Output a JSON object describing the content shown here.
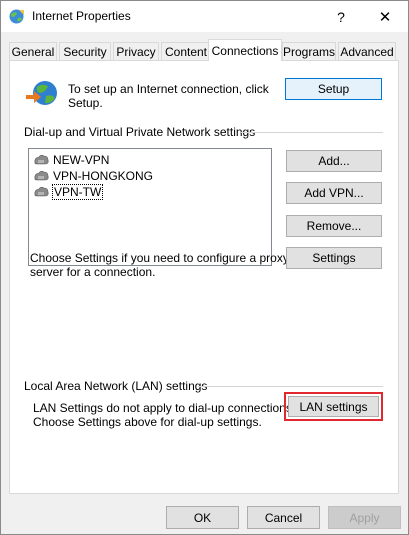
{
  "window": {
    "title": "Internet Properties",
    "help_glyph": "?",
    "close_glyph": "✕"
  },
  "tabs": [
    {
      "label": "General",
      "active": false
    },
    {
      "label": "Security",
      "active": false
    },
    {
      "label": "Privacy",
      "active": false
    },
    {
      "label": "Content",
      "active": false
    },
    {
      "label": "Connections",
      "active": true
    },
    {
      "label": "Programs",
      "active": false
    },
    {
      "label": "Advanced",
      "active": false
    }
  ],
  "setup_section": {
    "text_line1": "To set up an Internet connection, click",
    "text_line2": "Setup.",
    "setup_button": "Setup"
  },
  "dialup_section": {
    "heading": "Dial-up and Virtual Private Network settings",
    "connections": [
      {
        "label": "NEW-VPN",
        "selected": false
      },
      {
        "label": "VPN-HONGKONG",
        "selected": false
      },
      {
        "label": "VPN-TW",
        "selected": true
      }
    ],
    "add_button": "Add...",
    "add_vpn_button": "Add VPN...",
    "remove_button": "Remove...",
    "proxy_text_line1": "Choose Settings if you need to configure a proxy",
    "proxy_text_line2": "server for a connection.",
    "settings_button": "Settings"
  },
  "lan_section": {
    "heading": "Local Area Network (LAN) settings",
    "text_line1": "LAN Settings do not apply to dial-up connections.",
    "text_line2": "Choose Settings above for dial-up settings.",
    "lan_button": "LAN settings"
  },
  "footer": {
    "ok_button": "OK",
    "cancel_button": "Cancel",
    "apply_button": "Apply"
  },
  "colors": {
    "accent": "#0078d7",
    "highlight": "#e0282e"
  }
}
